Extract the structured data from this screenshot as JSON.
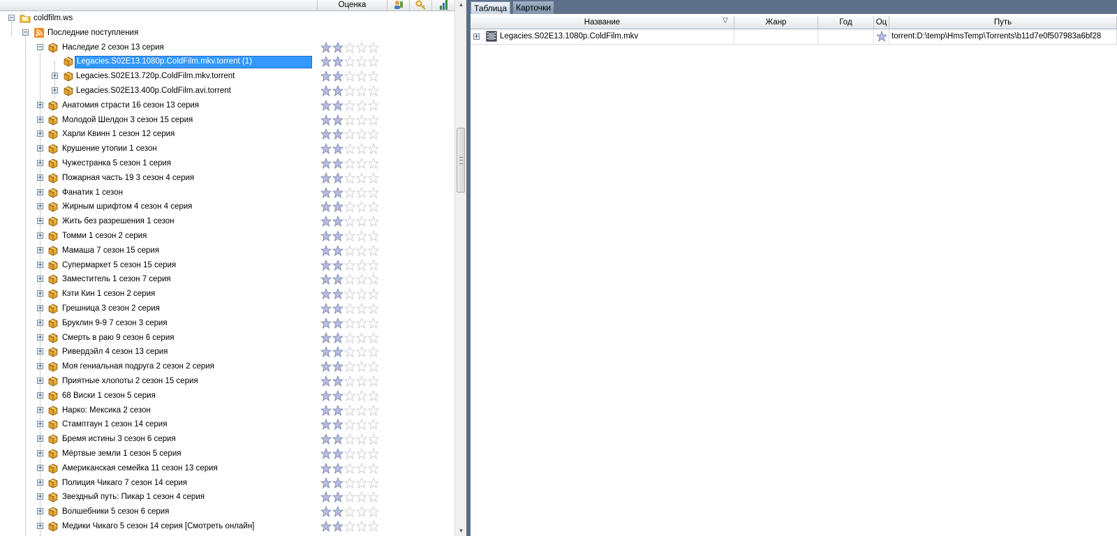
{
  "left_header": {
    "rating_label": "Оценка"
  },
  "tree": {
    "root": {
      "label": "coldfilm.ws",
      "icon": "site-folder-icon"
    },
    "feed": {
      "label": "Последние поступления",
      "icon": "rss-feed-icon"
    },
    "group": {
      "label": "Наследие 2 сезон 13 серия",
      "icon": "package-icon"
    },
    "torrents": [
      {
        "label": "Legacies.S02E13.1080p.ColdFilm.mkv.torrent (1)",
        "selected": true
      },
      {
        "label": "Legacies.S02E13.720p.ColdFilm.mkv.torrent",
        "selected": false
      },
      {
        "label": "Legacies.S02E13.400p.ColdFilm.avi.torrent",
        "selected": false
      }
    ],
    "series": [
      "Анатомия страсти 16 сезон 13 серия",
      "Молодой Шелдон 3 сезон 15 серия",
      "Харли Квинн 1 сезон 12 серия",
      "Крушение утопии 1 сезон",
      "Чужестранка 5 сезон 1 серия",
      "Пожарная часть 19 3 сезон 4 серия",
      "Фанатик 1 сезон",
      "Жирным шрифтом 4 сезон 4 серия",
      "Жить без разрешения 1 сезон",
      "Томми 1 сезон 2 серия",
      "Мамаша 7 сезон 15 серия",
      "Супермаркет 5 сезон 15 серия",
      "Заместитель 1 сезон 7 серия",
      "Кэти Кин 1 сезон 2 серия",
      "Грешница 3 сезон 2 серия",
      "Бруклин 9-9 7 сезон 3 серия",
      "Смерть в раю 9 сезон 6 серия",
      "Ривердэйл 4 сезон 13 серия",
      "Моя гениальная подруга 2 сезон 2 серия",
      "Приятные хлопоты 2 сезон 15 серия",
      "68 Виски 1 сезон 5 серия",
      "Нарко: Мексика 2 сезон",
      "Стамптаун 1 сезон 14 серия",
      "Бремя истины 3 сезон 6 серия",
      "Мёртвые земли 1 сезон 5 серия",
      "Американская семейка 11 сезон 13 серия",
      "Полиция Чикаго 7 сезон 14 серия",
      "Звездный путь: Пикар 1 сезон 4 серия",
      "Волшебники 5 сезон 6 серия",
      "Медики Чикаго 5 сезон 14 серия [Смотреть онлайн]"
    ],
    "rating_filled_of_5": 2
  },
  "right": {
    "tabs": [
      {
        "label": "Таблица",
        "active": true
      },
      {
        "label": "Карточки",
        "active": false
      }
    ],
    "columns": {
      "name": "Название",
      "genre": "Жанр",
      "year": "Год",
      "rating": "Оц",
      "path": "Путь"
    },
    "rows": [
      {
        "name": "Legacies.S02E13.1080p.ColdFilm.mkv",
        "genre": "",
        "year": "",
        "path": "torrent:D:\\temp\\HmsTemp\\Torrents\\b11d7e0f507983a6bf28"
      }
    ]
  },
  "colors": {
    "selection": "#3399ff",
    "panel_chrome": "#5d718a",
    "star_fill": "#b7bde0",
    "star_empty": "#ffffff"
  }
}
